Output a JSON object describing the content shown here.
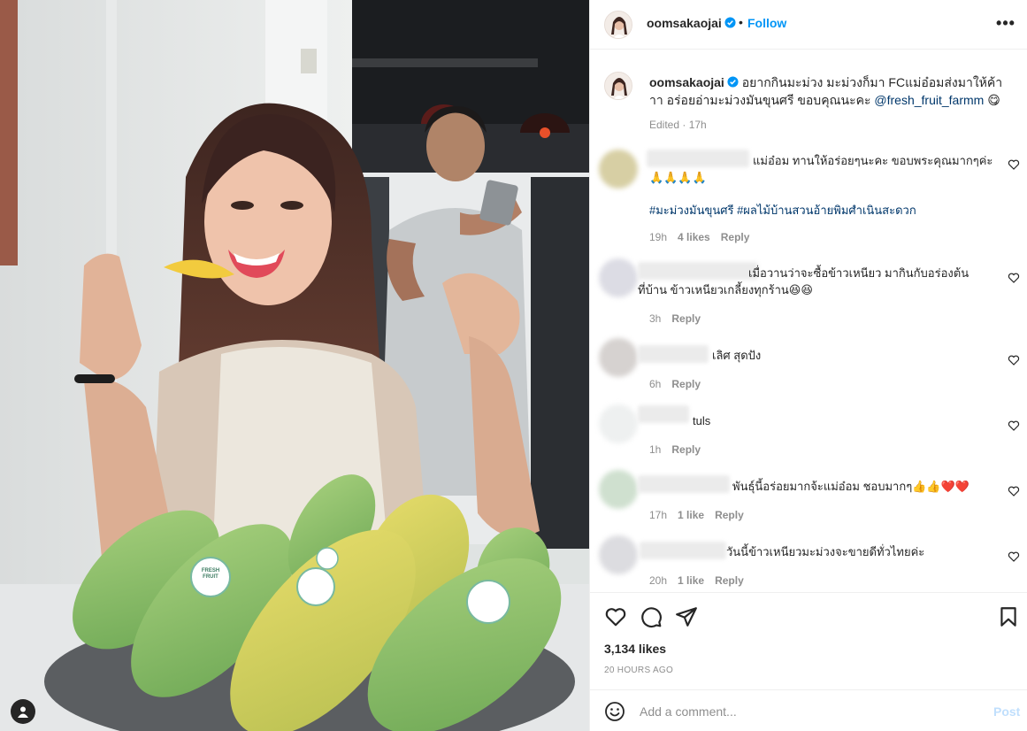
{
  "header": {
    "username": "oomsakaojai",
    "dot": "•",
    "follow_label": "Follow",
    "more_label": "•••"
  },
  "caption": {
    "username": "oomsakaojai",
    "text": "อยากกินมะม่วง มะม่วงก็มา FCแม่อ๋อมส่งมาให้ค้าาา อร่อยอ่ามะม่วงมันขุนศรี ขอบคุณนะคะ",
    "mention": "@fresh_fruit_farmm",
    "emoji": "😋",
    "edited": "Edited · 17h"
  },
  "comments": [
    {
      "text": "แม่อ๋อม ทานให้อร่อยๆนะคะ ขอบพระคุณมากๆค่ะ",
      "text2": "🙏🙏🙏🙏",
      "tags": "#มะม่วงมันขุนศรี #ผลไม้บ้านสวนอ้ายพิมศำเนินสะดวก",
      "time": "19h",
      "likes": "4 likes",
      "reply": "Reply"
    },
    {
      "text": "เมื่อวานว่าจะซื้อข้าวเหนียว มากินกับอร่องต้น",
      "text2": "ที่บ้าน ข้าวเหนียวเกลี้ยงทุกร้าน😆😆",
      "time": "3h",
      "reply": "Reply"
    },
    {
      "text": "เลิศ สุดปัง",
      "time": "6h",
      "reply": "Reply"
    },
    {
      "text": "tuls",
      "time": "1h",
      "reply": "Reply"
    },
    {
      "text": "พันธุ์นี้อร่อยมากจ้ะแม่อ๋อม ชอบมากๆ👍👍❤️❤️",
      "time": "17h",
      "likes": "1 like",
      "reply": "Reply"
    },
    {
      "text": "วันนี้ข้าวเหนียวมะม่วงจะขายดีทั่วไทยค่ะ",
      "time": "20h",
      "likes": "1 like",
      "reply": "Reply"
    }
  ],
  "post_actions": {
    "likes": "3,134 likes",
    "timestamp": "20 HOURS AGO"
  },
  "add_comment": {
    "placeholder": "Add a comment...",
    "post_label": "Post"
  },
  "photo": {
    "sticker_text": "FRESH FRUIT"
  },
  "colors": {
    "accent": "#0095f6",
    "link": "#00376b",
    "muted": "#8e8e8e",
    "post_disabled": "#c0dffd",
    "mango_green": "#8cc26a",
    "mango_yellow": "#d8cc4e"
  }
}
